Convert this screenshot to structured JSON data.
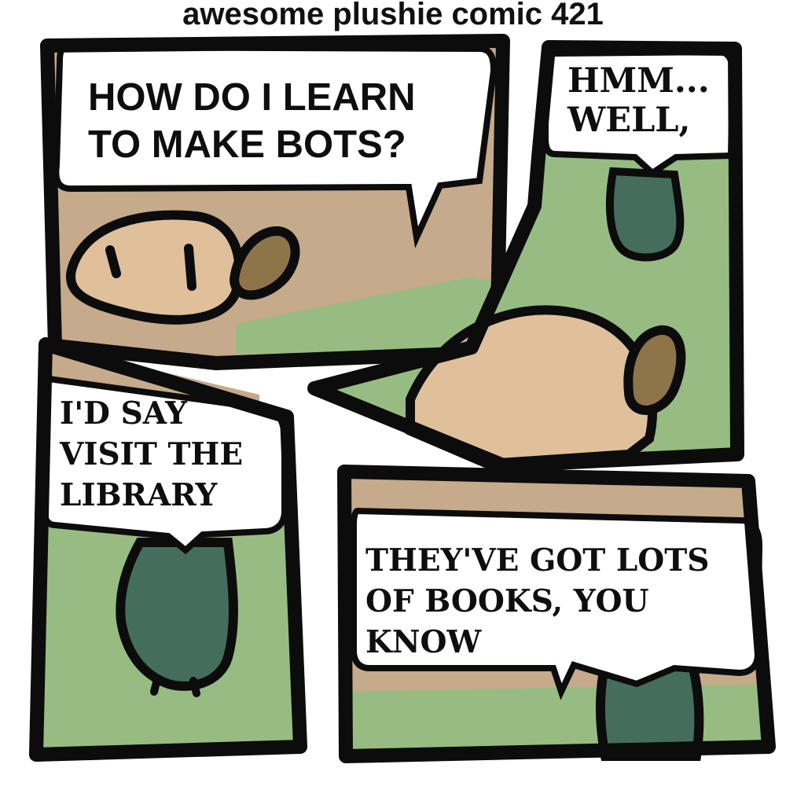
{
  "title": "awesome plushie comic 421",
  "panels": [
    {
      "speech": "HOW DO I LEARN\nTO MAKE BOTS?"
    },
    {
      "speech": "HMM...\nWELL,"
    },
    {
      "speech": "I'D SAY\nVISIT THE\nLIBRARY"
    },
    {
      "speech": "THEY'VE GOT LOTS\nOF BOOKS, YOU\nKNOW"
    }
  ],
  "colors": {
    "grass": "#97bc82",
    "wall": "#c5aa8b",
    "plush_body": "#dfc09a",
    "plush_ear": "#8e7449",
    "bird_plush": "#456d5e",
    "outline": "#0c0c0c",
    "bubble": "#ffffff"
  }
}
